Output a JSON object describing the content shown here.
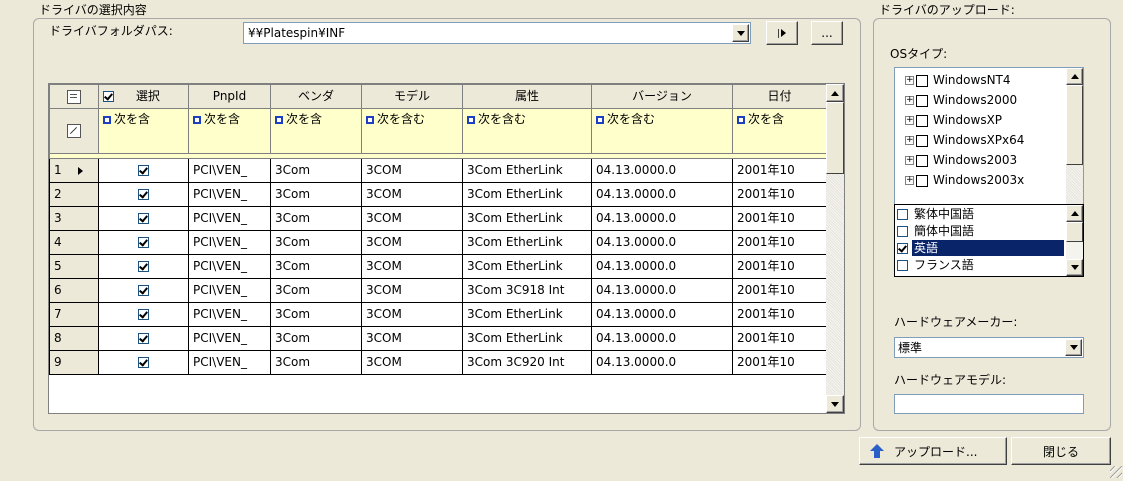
{
  "left_group": {
    "title": "ドライバの選択内容",
    "folder_label": "ドライバフォルダパス:",
    "folder_value": "¥¥Platespin¥INF",
    "browse_label": "..."
  },
  "grid": {
    "columns": [
      "選択",
      "PnpId",
      "ベンダ",
      "モデル",
      "属性",
      "バージョン",
      "日付"
    ],
    "filters": [
      "次を含",
      "次を含",
      "次を含",
      "次を含む",
      "次を含む",
      "次を含む",
      "次を含"
    ],
    "rows": [
      {
        "num": "1",
        "pnpid": "PCI\\VEN_",
        "vendor": "3Com",
        "model": "3COM",
        "attr": "3Com EtherLink",
        "version": "04.13.0000.0",
        "date": "2001年10"
      },
      {
        "num": "2",
        "pnpid": "PCI\\VEN_",
        "vendor": "3Com",
        "model": "3COM",
        "attr": "3Com EtherLink",
        "version": "04.13.0000.0",
        "date": "2001年10"
      },
      {
        "num": "3",
        "pnpid": "PCI\\VEN_",
        "vendor": "3Com",
        "model": "3COM",
        "attr": "3Com EtherLink",
        "version": "04.13.0000.0",
        "date": "2001年10"
      },
      {
        "num": "4",
        "pnpid": "PCI\\VEN_",
        "vendor": "3Com",
        "model": "3COM",
        "attr": "3Com EtherLink",
        "version": "04.13.0000.0",
        "date": "2001年10"
      },
      {
        "num": "5",
        "pnpid": "PCI\\VEN_",
        "vendor": "3Com",
        "model": "3COM",
        "attr": "3Com EtherLink",
        "version": "04.13.0000.0",
        "date": "2001年10"
      },
      {
        "num": "6",
        "pnpid": "PCI\\VEN_",
        "vendor": "3Com",
        "model": "3COM",
        "attr": "3Com 3C918 Int",
        "version": "04.13.0000.0",
        "date": "2001年10"
      },
      {
        "num": "7",
        "pnpid": "PCI\\VEN_",
        "vendor": "3Com",
        "model": "3COM",
        "attr": "3Com EtherLink",
        "version": "04.13.0000.0",
        "date": "2001年10"
      },
      {
        "num": "8",
        "pnpid": "PCI\\VEN_",
        "vendor": "3Com",
        "model": "3COM",
        "attr": "3Com EtherLink",
        "version": "04.13.0000.0",
        "date": "2001年10"
      },
      {
        "num": "9",
        "pnpid": "PCI\\VEN_",
        "vendor": "3Com",
        "model": "3COM",
        "attr": "3Com 3C920 Int",
        "version": "04.13.0000.0",
        "date": "2001年10"
      }
    ]
  },
  "right_group": {
    "title": "ドライバのアップロード:",
    "os_label": "OSタイプ:",
    "os_items": [
      "WindowsNT4",
      "Windows2000",
      "WindowsXP",
      "WindowsXPx64",
      "Windows2003",
      "Windows2003x"
    ],
    "languages": [
      {
        "label": "繁体中国語",
        "checked": false
      },
      {
        "label": "簡体中国語",
        "checked": false
      },
      {
        "label": "英語",
        "checked": true
      },
      {
        "label": "フランス語",
        "checked": false
      }
    ],
    "hw_maker_label": "ハードウェアメーカー:",
    "hw_maker_value": "標準",
    "hw_model_label": "ハードウェアモデル:",
    "hw_model_value": ""
  },
  "buttons": {
    "upload": "アップロード...",
    "close": "閉じる"
  },
  "colors": {
    "window_bg": "#ece9d8",
    "filter_bg": "#ffffcc",
    "selection": "#0a246a",
    "input_border": "#7f9db9"
  }
}
